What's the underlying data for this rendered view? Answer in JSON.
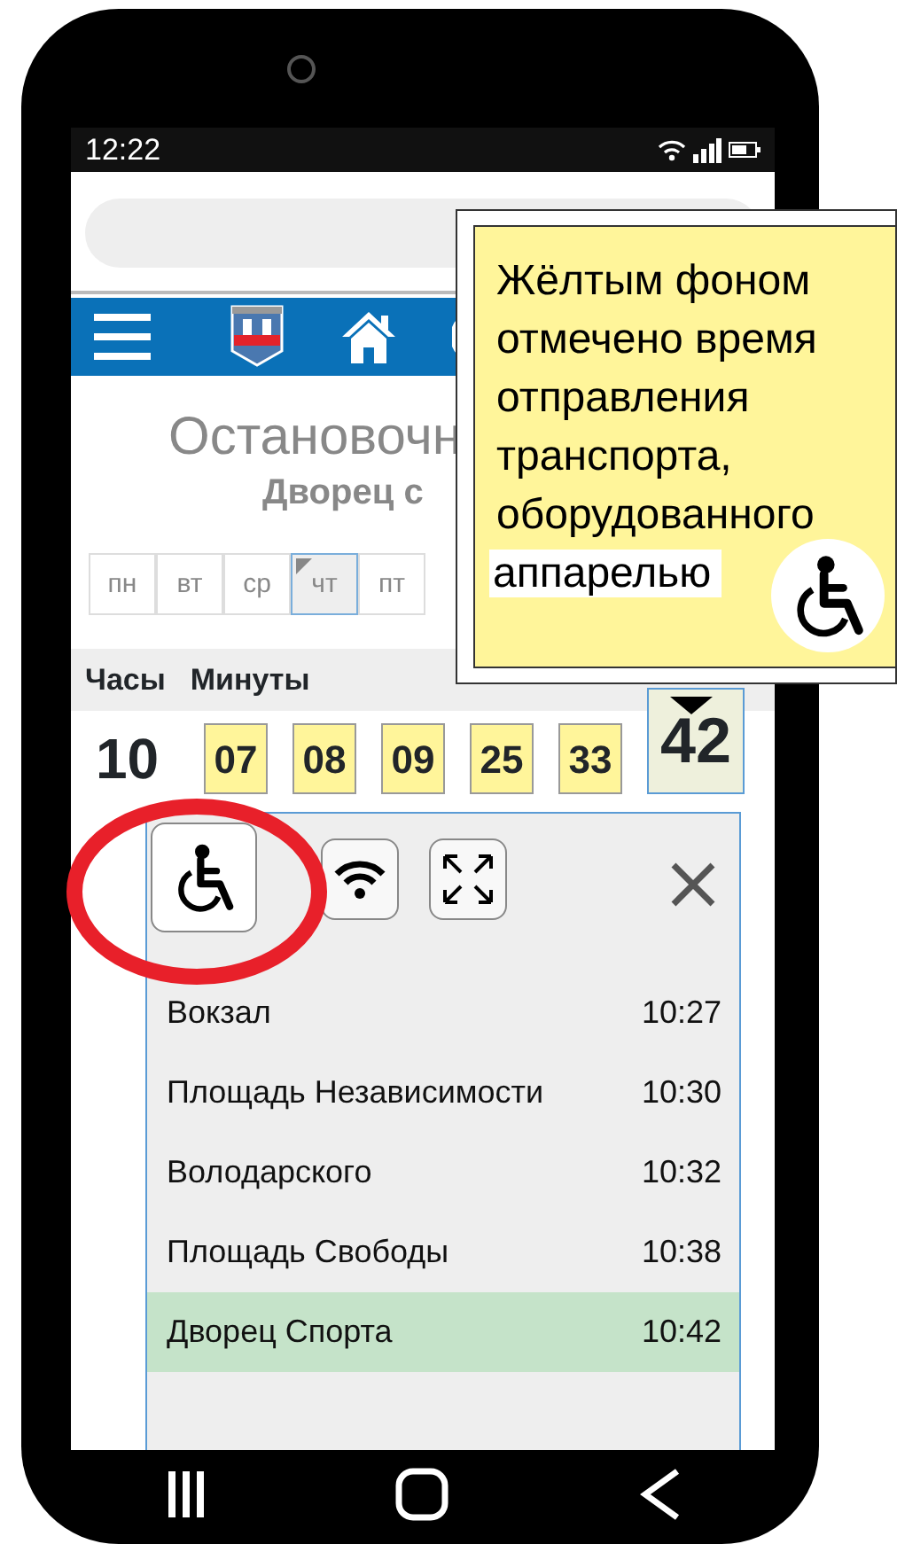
{
  "status_bar": {
    "time": "12:22"
  },
  "stop": {
    "title": "Остановочн",
    "subtitle": "Дворец с"
  },
  "days": [
    {
      "label": "пн",
      "selected": false
    },
    {
      "label": "вт",
      "selected": false
    },
    {
      "label": "ср",
      "selected": false
    },
    {
      "label": "чт",
      "selected": true
    },
    {
      "label": "пт",
      "selected": false
    }
  ],
  "timetable": {
    "headers": [
      "Часы",
      "Минуты"
    ],
    "hour": "10",
    "minutes": [
      {
        "value": "07",
        "ramp": true,
        "selected": false
      },
      {
        "value": "08",
        "ramp": true,
        "selected": false
      },
      {
        "value": "09",
        "ramp": true,
        "selected": false
      },
      {
        "value": "25",
        "ramp": true,
        "selected": false
      },
      {
        "value": "33",
        "ramp": true,
        "selected": false
      },
      {
        "value": "42",
        "ramp": true,
        "selected": true
      }
    ]
  },
  "panel": {
    "buttons": [
      {
        "kind": "wheelchair",
        "selected": true
      },
      {
        "kind": "wifi",
        "selected": false
      },
      {
        "kind": "expand",
        "selected": false
      }
    ],
    "stops": [
      {
        "name": "Вокзал",
        "time": "10:27",
        "selected": false
      },
      {
        "name": "Площадь Независимости",
        "time": "10:30",
        "selected": false
      },
      {
        "name": "Володарского",
        "time": "10:32",
        "selected": false
      },
      {
        "name": "Площадь Свободы",
        "time": "10:38",
        "selected": false
      },
      {
        "name": "Дворец Спорта",
        "time": "10:42",
        "selected": true
      }
    ]
  },
  "callout": {
    "lines": [
      {
        "text": "Жёлтым фоном",
        "highlight": false
      },
      {
        "text": "отмечено время",
        "highlight": false
      },
      {
        "text": "отправления",
        "highlight": false
      },
      {
        "text": "транспорта,",
        "highlight": false
      },
      {
        "text": "оборудованного",
        "highlight": false
      },
      {
        "text": "аппарелью",
        "highlight": true
      }
    ]
  }
}
